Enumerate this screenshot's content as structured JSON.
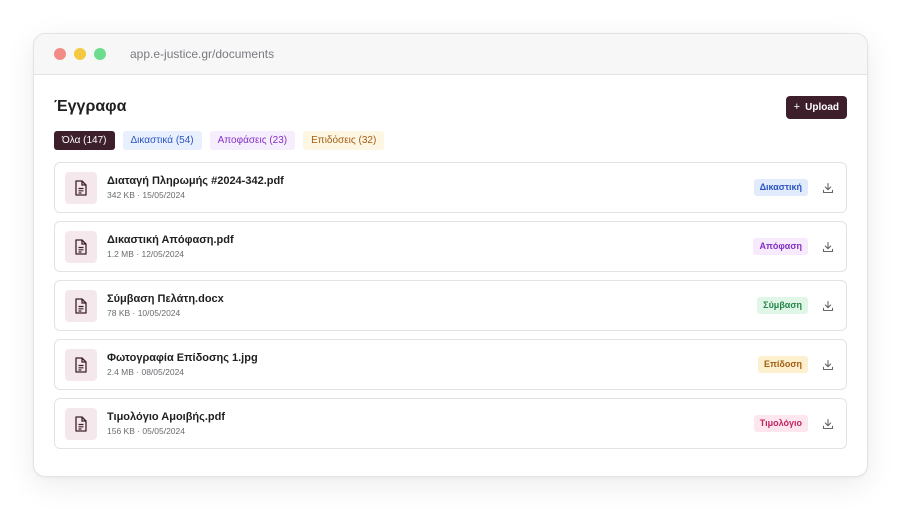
{
  "browser": {
    "url": "app.e-justice.gr/documents"
  },
  "header": {
    "title": "Έγγραφα",
    "upload_label": "Upload",
    "upload_icon": "plus-icon"
  },
  "filters": [
    {
      "label": "Όλα (147)",
      "active": true
    },
    {
      "label": "Δικαστικά (54)"
    },
    {
      "label": "Αποφάσεις (23)"
    },
    {
      "label": "Επιδόσεις (32)"
    }
  ],
  "files": [
    {
      "name": "Διαταγή Πληρωμής #2024-342.pdf",
      "meta": "342 KB · 15/05/2024",
      "badge": "Δικαστική",
      "badge_color": "#2b55c4"
    },
    {
      "name": "Δικαστική Απόφαση.pdf",
      "meta": "1.2 MB · 12/05/2024",
      "badge": "Απόφαση",
      "badge_color": "#8331c5"
    },
    {
      "name": "Σύμβαση Πελάτη.docx",
      "meta": "78 KB · 10/05/2024",
      "badge": "Σύμβαση",
      "badge_color": "#25864a"
    },
    {
      "name": "Φωτογραφία Επίδοσης 1.jpg",
      "meta": "2.4 MB · 08/05/2024",
      "badge": "Επίδοση",
      "badge_color": "#a35c10"
    },
    {
      "name": "Τιμολόγιο Αμοιβής.pdf",
      "meta": "156 KB · 05/05/2024",
      "badge": "Τιμολόγιο",
      "badge_color": "#be2560"
    }
  ],
  "colors": {
    "accent": "#3d1f2b",
    "file_icon_bg": "#f5e8ec"
  }
}
